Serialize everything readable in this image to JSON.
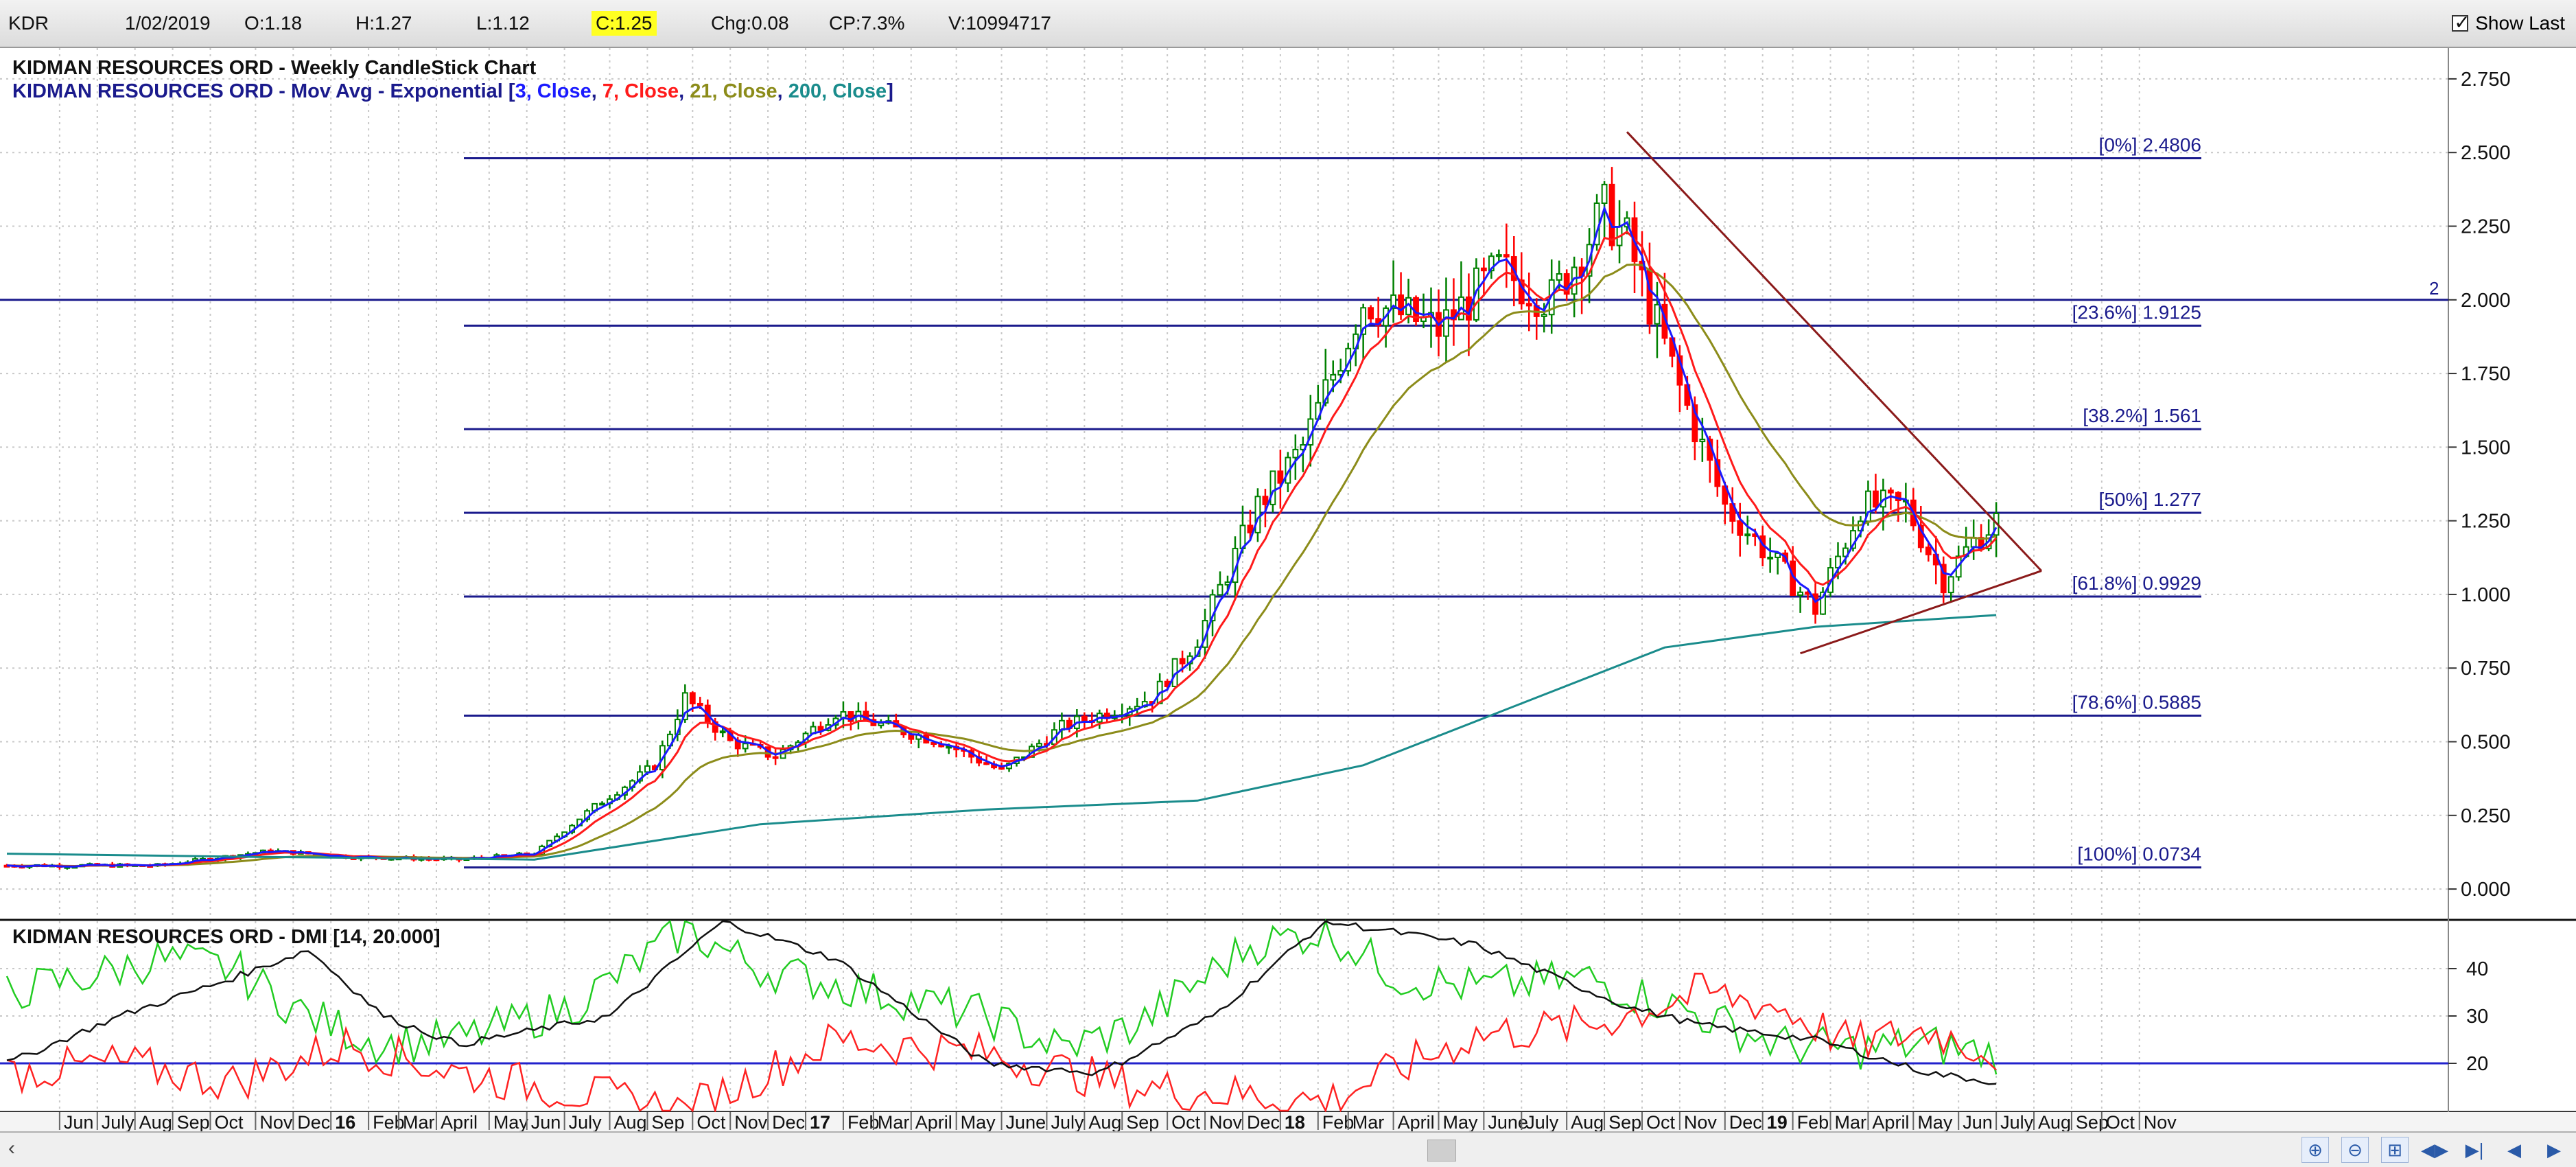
{
  "toolbar": {
    "symbol": "KDR",
    "date": "1/02/2019",
    "open": "O:1.18",
    "high": "H:1.27",
    "low": "L:1.12",
    "close": "C:1.25",
    "change": "Chg:0.08",
    "change_pct": "CP:7.3%",
    "volume": "V:10994717",
    "show_last_label": "Show Last",
    "show_last_checked": true
  },
  "navigation": {
    "icons": [
      "scroll-left-icon",
      "zoom-in-icon",
      "zoom-out-icon",
      "fit-icon",
      "start-icon",
      "end-icon",
      "step-back-icon",
      "step-forward-icon"
    ]
  },
  "chart_data": [
    {
      "type": "candlestick",
      "title": "KIDMAN RESOURCES ORD - Weekly CandleStick Chart",
      "overlay_label": {
        "prefix": "KIDMAN RESOURCES ORD - Mov Avg - Exponential [",
        "items": [
          {
            "text": "3, Close",
            "color": "#1a1aff"
          },
          {
            "text": "7, Close",
            "color": "#ff1a1a"
          },
          {
            "text": "21, Close",
            "color": "#8c8c1a"
          },
          {
            "text": "200, Close",
            "color": "#1a8c8c"
          }
        ],
        "suffix": "]"
      },
      "ylim": [
        -0.1,
        2.85
      ],
      "yticks": [
        "0.000",
        "0.250",
        "0.500",
        "0.750",
        "1.000",
        "1.250",
        "1.500",
        "1.750",
        "2.000",
        "2.250",
        "2.500",
        "2.750"
      ],
      "grid": true,
      "horizontal_marker": {
        "value": 2.0,
        "label": "2"
      },
      "fibonacci": [
        {
          "label": "[0%] 2.4806",
          "value": 2.4806
        },
        {
          "label": "[23.6%] 1.9125",
          "value": 1.9125
        },
        {
          "label": "[38.2%] 1.561",
          "value": 1.561
        },
        {
          "label": "[50%] 1.277",
          "value": 1.277
        },
        {
          "label": "[61.8%] 0.9929",
          "value": 0.9929
        },
        {
          "label": "[78.6%] 0.5885",
          "value": 0.5885
        },
        {
          "label": "[100%] 0.0734",
          "value": 0.0734
        }
      ],
      "colors": {
        "up": "#008000",
        "down": "#ff0000",
        "ema3": "#1a1aff",
        "ema7": "#ff1a1a",
        "ema21": "#8c8c1a",
        "ema200": "#1a8c8c",
        "fib": "#1a1a8c",
        "trendline": "#8b1a1a"
      },
      "price_path": [
        [
          0,
          0.08
        ],
        [
          20,
          0.08
        ],
        [
          35,
          0.13
        ],
        [
          45,
          0.11
        ],
        [
          60,
          0.1
        ],
        [
          70,
          0.12
        ],
        [
          78,
          0.28
        ],
        [
          86,
          0.42
        ],
        [
          90,
          0.65
        ],
        [
          96,
          0.5
        ],
        [
          102,
          0.45
        ],
        [
          110,
          0.6
        ],
        [
          124,
          0.5
        ],
        [
          132,
          0.4
        ],
        [
          140,
          0.55
        ],
        [
          152,
          0.65
        ],
        [
          158,
          0.85
        ],
        [
          166,
          1.3
        ],
        [
          172,
          1.5
        ],
        [
          180,
          2.0
        ],
        [
          190,
          1.9
        ],
        [
          198,
          2.1
        ],
        [
          205,
          2.0
        ],
        [
          212,
          2.3
        ],
        [
          215,
          2.2
        ],
        [
          222,
          1.7
        ],
        [
          228,
          1.3
        ],
        [
          235,
          1.1
        ],
        [
          240,
          0.95
        ],
        [
          246,
          1.3
        ],
        [
          252,
          1.3
        ],
        [
          257,
          1.05
        ],
        [
          261,
          1.18
        ],
        [
          264,
          1.25
        ]
      ],
      "ema200_path": [
        [
          0,
          0.12
        ],
        [
          30,
          0.11
        ],
        [
          70,
          0.1
        ],
        [
          100,
          0.22
        ],
        [
          130,
          0.27
        ],
        [
          158,
          0.3
        ],
        [
          180,
          0.42
        ],
        [
          200,
          0.62
        ],
        [
          220,
          0.82
        ],
        [
          240,
          0.89
        ],
        [
          264,
          0.93
        ]
      ],
      "trendlines": [
        {
          "from": [
            215,
            2.57
          ],
          "to": [
            270,
            1.08
          ]
        },
        {
          "from": [
            238,
            0.8
          ],
          "to": [
            270,
            1.08
          ]
        }
      ],
      "x_range": [
        0,
        324
      ]
    },
    {
      "type": "line",
      "title": "KIDMAN RESOURCES ORD - DMI [14, 20.000]",
      "ylim": [
        10,
        50
      ],
      "yticks": [
        "20",
        "30",
        "40"
      ],
      "threshold": 20,
      "series": [
        {
          "color": "#22cc22",
          "values": [
            [
              0,
              35
            ],
            [
              10,
              38
            ],
            [
              20,
              42
            ],
            [
              30,
              40
            ],
            [
              40,
              30
            ],
            [
              50,
              24
            ],
            [
              60,
              25
            ],
            [
              75,
              32
            ],
            [
              90,
              48
            ],
            [
              100,
              40
            ],
            [
              115,
              35
            ],
            [
              130,
              30
            ],
            [
              140,
              23
            ],
            [
              150,
              28
            ],
            [
              165,
              45
            ],
            [
              175,
              48
            ],
            [
              185,
              38
            ],
            [
              195,
              36
            ],
            [
              210,
              38
            ],
            [
              225,
              30
            ],
            [
              235,
              24
            ],
            [
              245,
              23
            ],
            [
              255,
              24
            ],
            [
              264,
              22
            ]
          ]
        },
        {
          "color": "#ff2222",
          "values": [
            [
              0,
              18
            ],
            [
              15,
              20
            ],
            [
              30,
              16
            ],
            [
              45,
              24
            ],
            [
              60,
              18
            ],
            [
              75,
              14
            ],
            [
              90,
              10
            ],
            [
              110,
              25
            ],
            [
              130,
              22
            ],
            [
              150,
              15
            ],
            [
              175,
              12
            ],
            [
              195,
              26
            ],
            [
              210,
              28
            ],
            [
              225,
              35
            ],
            [
              235,
              32
            ],
            [
              245,
              24
            ],
            [
              255,
              27
            ],
            [
              264,
              22
            ]
          ]
        },
        {
          "color": "#111111",
          "values": [
            [
              0,
              20
            ],
            [
              15,
              30
            ],
            [
              30,
              38
            ],
            [
              40,
              44
            ],
            [
              50,
              30
            ],
            [
              60,
              24
            ],
            [
              80,
              30
            ],
            [
              95,
              50
            ],
            [
              110,
              42
            ],
            [
              130,
              20
            ],
            [
              145,
              18
            ],
            [
              160,
              30
            ],
            [
              175,
              50
            ],
            [
              195,
              45
            ],
            [
              215,
              32
            ],
            [
              225,
              28
            ],
            [
              240,
              25
            ],
            [
              255,
              18
            ],
            [
              264,
              16
            ]
          ]
        }
      ]
    }
  ],
  "x_axis": {
    "labels": [
      {
        "t": 7,
        "text": "Jun"
      },
      {
        "t": 12,
        "text": "July"
      },
      {
        "t": 17,
        "text": "Aug"
      },
      {
        "t": 22,
        "text": "Sep"
      },
      {
        "t": 27,
        "text": "Oct"
      },
      {
        "t": 33,
        "text": "Nov"
      },
      {
        "t": 38,
        "text": "Dec"
      },
      {
        "t": 43,
        "text": "16",
        "bold": true
      },
      {
        "t": 48,
        "text": "Feb"
      },
      {
        "t": 52,
        "text": "Mar"
      },
      {
        "t": 57,
        "text": "April"
      },
      {
        "t": 64,
        "text": "May"
      },
      {
        "t": 69,
        "text": "Jun"
      },
      {
        "t": 74,
        "text": "July"
      },
      {
        "t": 80,
        "text": "Aug"
      },
      {
        "t": 85,
        "text": "Sep"
      },
      {
        "t": 91,
        "text": "Oct"
      },
      {
        "t": 96,
        "text": "Nov"
      },
      {
        "t": 101,
        "text": "Dec"
      },
      {
        "t": 106,
        "text": "17",
        "bold": true
      },
      {
        "t": 111,
        "text": "Feb"
      },
      {
        "t": 115,
        "text": "Mar"
      },
      {
        "t": 120,
        "text": "April"
      },
      {
        "t": 126,
        "text": "May"
      },
      {
        "t": 132,
        "text": "June"
      },
      {
        "t": 138,
        "text": "July"
      },
      {
        "t": 143,
        "text": "Aug"
      },
      {
        "t": 148,
        "text": "Sep"
      },
      {
        "t": 154,
        "text": "Oct"
      },
      {
        "t": 159,
        "text": "Nov"
      },
      {
        "t": 164,
        "text": "Dec"
      },
      {
        "t": 169,
        "text": "18",
        "bold": true
      },
      {
        "t": 174,
        "text": "Feb"
      },
      {
        "t": 178,
        "text": "Mar"
      },
      {
        "t": 184,
        "text": "April"
      },
      {
        "t": 190,
        "text": "May"
      },
      {
        "t": 196,
        "text": "June"
      },
      {
        "t": 201,
        "text": "July"
      },
      {
        "t": 207,
        "text": "Aug"
      },
      {
        "t": 212,
        "text": "Sep"
      },
      {
        "t": 217,
        "text": "Oct"
      },
      {
        "t": 222,
        "text": "Nov"
      },
      {
        "t": 228,
        "text": "Dec"
      },
      {
        "t": 233,
        "text": "19",
        "bold": true
      },
      {
        "t": 237,
        "text": "Feb"
      },
      {
        "t": 242,
        "text": "Mar"
      },
      {
        "t": 247,
        "text": "April"
      },
      {
        "t": 253,
        "text": "May"
      },
      {
        "t": 259,
        "text": "Jun"
      },
      {
        "t": 264,
        "text": "July"
      },
      {
        "t": 269,
        "text": "Aug"
      },
      {
        "t": 274,
        "text": "Sep"
      },
      {
        "t": 278,
        "text": "Oct"
      },
      {
        "t": 283,
        "text": "Nov"
      }
    ]
  }
}
